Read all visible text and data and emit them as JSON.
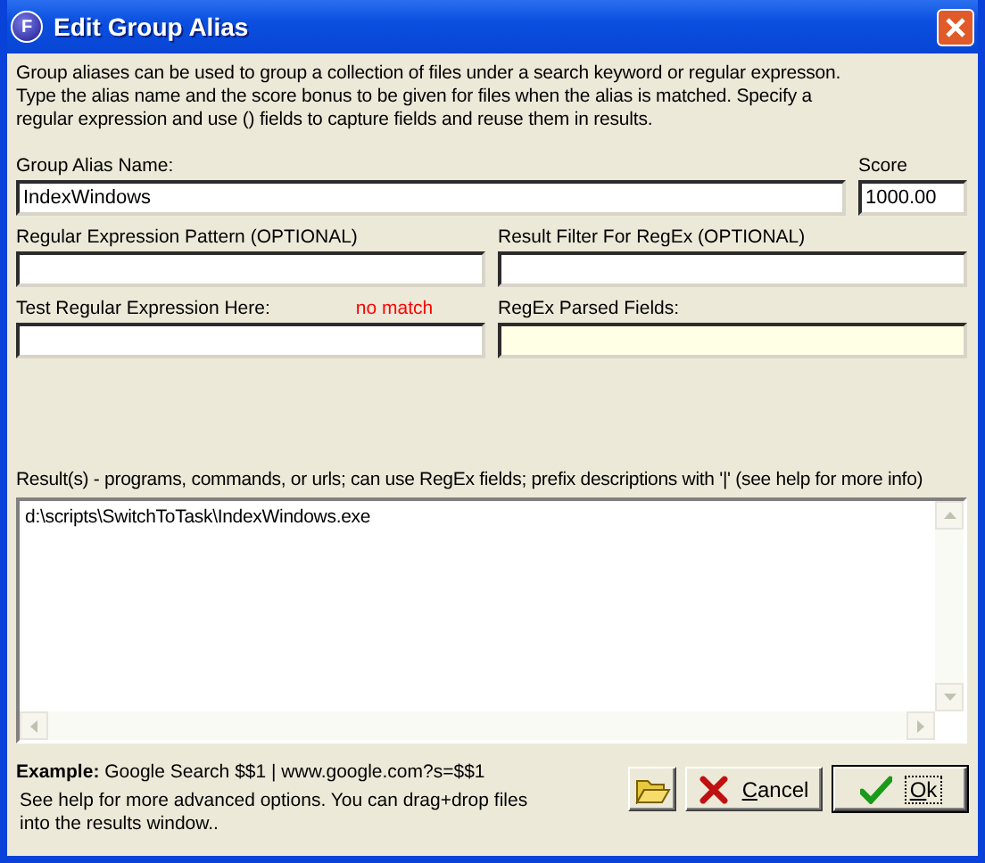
{
  "window": {
    "title": "Edit Group Alias",
    "app_icon": "F"
  },
  "intro": [
    "Group aliases can be used to group a collection of files under a search keyword or regular expresson.",
    "Type the alias name and the score bonus to be given for files when the alias is matched.  Specify a regular expression and use () fields to capture fields and reuse them in results."
  ],
  "alias_name": {
    "label": "Group Alias Name:",
    "value": "IndexWindows"
  },
  "score": {
    "label": "Score",
    "value": "1000.00"
  },
  "regex_pattern": {
    "label": "Regular Expression Pattern (OPTIONAL)"
  },
  "result_filter": {
    "label": "Result Filter For RegEx (OPTIONAL)"
  },
  "test_regex": {
    "label": "Test Regular Expression Here:",
    "status": "no match"
  },
  "parsed_fields": {
    "label": "RegEx Parsed Fields:"
  },
  "results": {
    "label": "Result(s) - programs, commands, or urls; can use RegEx fields; prefix descriptions with '|' (see help for more info)",
    "value": "d:\\scripts\\SwitchToTask\\IndexWindows.exe"
  },
  "example": "**Example:** Google Search $$1 | www.google.com?s=$$1",
  "help_text": "See help for more advanced options.  You can drag+drop files into the results window..",
  "buttons": [
    {
      "kind": "browse"
    },
    {
      "kind": "cancel",
      "label": "Cancel"
    },
    {
      "kind": "ok",
      "label": "Ok",
      "default": true
    }
  ]
}
